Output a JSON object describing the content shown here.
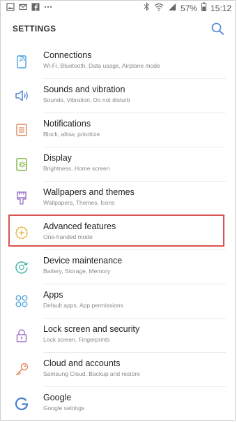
{
  "status": {
    "battery": "57%",
    "time": "15:12"
  },
  "header": {
    "title": "SETTINGS"
  },
  "items": [
    {
      "title": "Connections",
      "subtitle": "Wi-Fi, Bluetooth, Data usage, Airplane mode",
      "icon": "connections-icon",
      "color": "#4aa3df"
    },
    {
      "title": "Sounds and vibration",
      "subtitle": "Sounds, Vibration, Do not disturb",
      "icon": "speaker-icon",
      "color": "#4a7fd0"
    },
    {
      "title": "Notifications",
      "subtitle": "Block, allow, prioritize",
      "icon": "notifications-icon",
      "color": "#e2835c"
    },
    {
      "title": "Display",
      "subtitle": "Brightness, Home screen",
      "icon": "display-icon",
      "color": "#7bb33a"
    },
    {
      "title": "Wallpapers and themes",
      "subtitle": "Wallpapers, Themes, Icons",
      "icon": "brush-icon",
      "color": "#9a6fc7"
    },
    {
      "title": "Advanced features",
      "subtitle": "One-handed mode",
      "icon": "gear-plus-icon",
      "color": "#e3b13b"
    },
    {
      "title": "Device maintenance",
      "subtitle": "Battery, Storage, Memory",
      "icon": "maintenance-icon",
      "color": "#3bb3a0"
    },
    {
      "title": "Apps",
      "subtitle": "Default apps, App permissions",
      "icon": "apps-icon",
      "color": "#4aa3df"
    },
    {
      "title": "Lock screen and security",
      "subtitle": "Lock screen, Fingerprints",
      "icon": "lock-icon",
      "color": "#9a6fc7"
    },
    {
      "title": "Cloud and accounts",
      "subtitle": "Samsung Cloud, Backup and restore",
      "icon": "key-icon",
      "color": "#e2835c"
    },
    {
      "title": "Google",
      "subtitle": "Google settings",
      "icon": "google-icon",
      "color": "#4a7fd0"
    }
  ]
}
